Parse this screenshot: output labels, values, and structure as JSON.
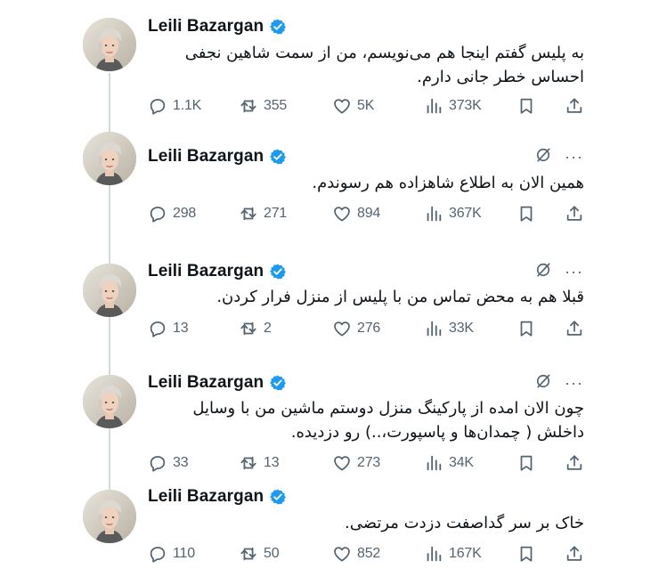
{
  "tweets": [
    {
      "name": "Leili Bazargan",
      "show_grok": false,
      "text": "به پلیس گفتم اینجا هم می‌نویسم، من از سمت شاهین نجفی احساس خطر جانی دارم.",
      "replies": "1.1K",
      "reposts": "355",
      "likes": "5K",
      "views": "373K"
    },
    {
      "name": "Leili Bazargan",
      "show_grok": true,
      "text": "همین الان به اطلاع شاهزاده هم رسوندم.",
      "replies": "298",
      "reposts": "271",
      "likes": "894",
      "views": "367K"
    },
    {
      "name": "Leili Bazargan",
      "show_grok": true,
      "text": "قبلا هم به محض تماس من با پلیس از منزل فرار کردن.",
      "replies": "13",
      "reposts": "2",
      "likes": "276",
      "views": "33K"
    },
    {
      "name": "Leili Bazargan",
      "show_grok": true,
      "text": "چون الان امده از پارکینگ منزل دوستم ماشین من با وسایل داخلش ( چمدان‌ها و پاسپورت،..) رو دزدیده.",
      "replies": "33",
      "reposts": "13",
      "likes": "273",
      "views": "34K"
    },
    {
      "name": "Leili Bazargan",
      "show_grok": false,
      "text": "خاک بر سر گداصفت دزدت مرتضی.",
      "replies": "110",
      "reposts": "50",
      "likes": "852",
      "views": "167K"
    }
  ],
  "icons": {
    "reply": "reply-icon",
    "repost": "repost-icon",
    "like": "like-icon",
    "views": "views-icon",
    "bookmark": "bookmark-icon",
    "share": "share-icon",
    "verified": "verified-badge-icon",
    "grok": "grok-icon",
    "more": "more-icon"
  },
  "colors": {
    "text": "#0f1419",
    "muted": "#536471",
    "verified": "#1d9bf0",
    "thread_line": "#cfd9de"
  }
}
